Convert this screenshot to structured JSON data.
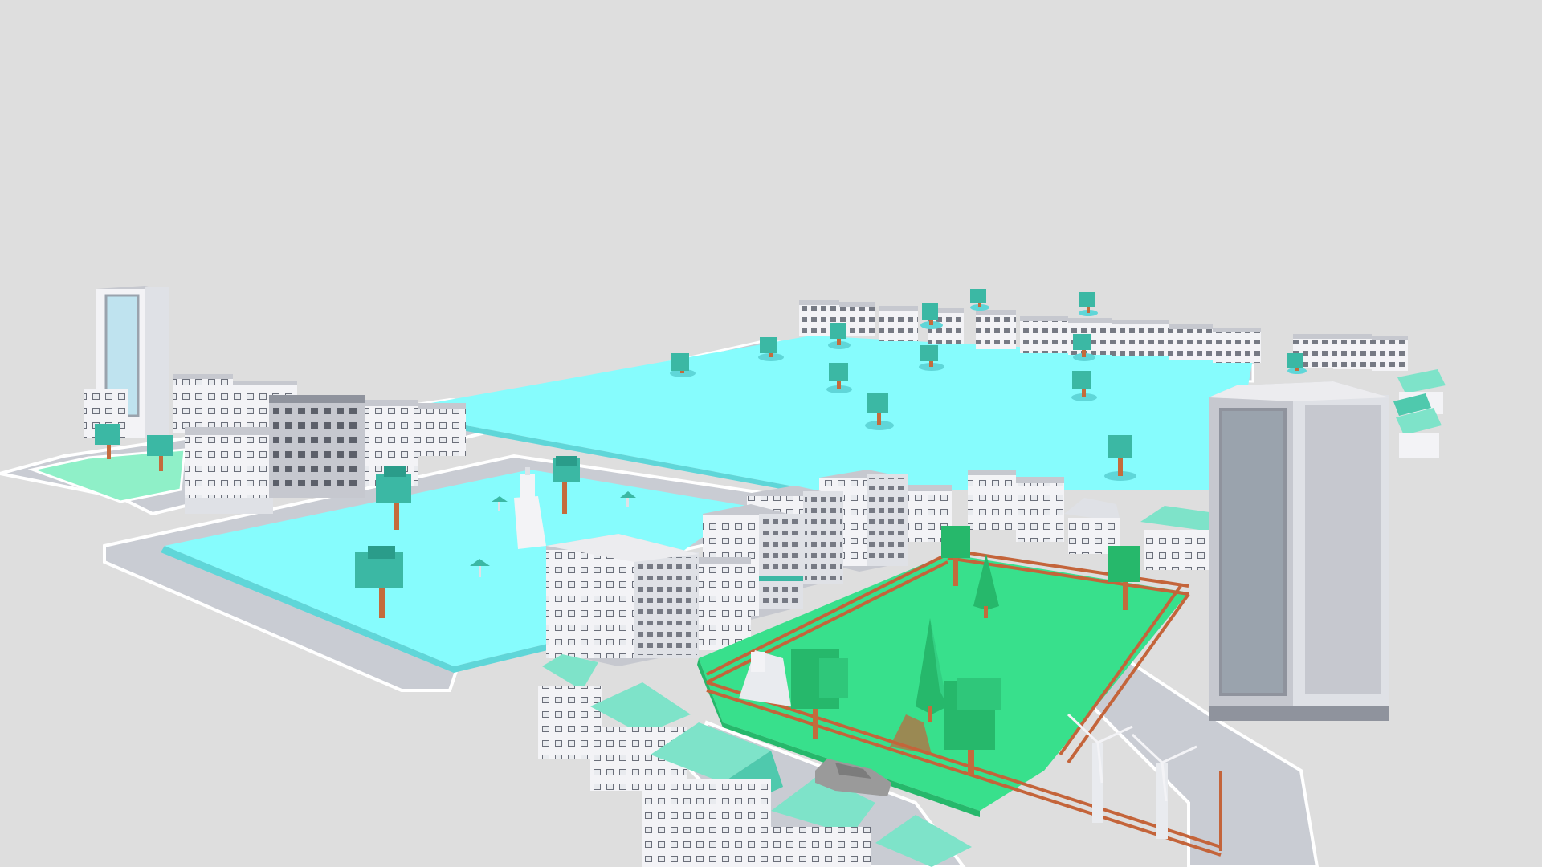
{
  "scene": {
    "subject": "low-poly-city",
    "palette": {
      "background": "#dedede",
      "road": "#c9ccd3",
      "curb": "#ffffff",
      "lot_cyan": "#86fcfd",
      "lot_cyan_side": "#5fd6d8",
      "park_green": "#38e08c",
      "park_green_dark": "#26b86b",
      "grass_mint": "#8ff0c8",
      "building_light": "#f3f3f6",
      "building_side": "#c6c8cf",
      "building_dark": "#8f939d",
      "window": "#6b6f7a",
      "tower_glass": "#9aa3ad",
      "tower_glass_blue": "#bfe3ef",
      "roof_mint": "#7ee3c9",
      "roof_mint_dark": "#4fc9ad",
      "tree_top": "#3bb8a4",
      "tree_top_dark": "#2a9c8a",
      "tree_trunk": "#c46b3c",
      "fence": "#c4643a",
      "car": "#9a9a9a"
    }
  }
}
